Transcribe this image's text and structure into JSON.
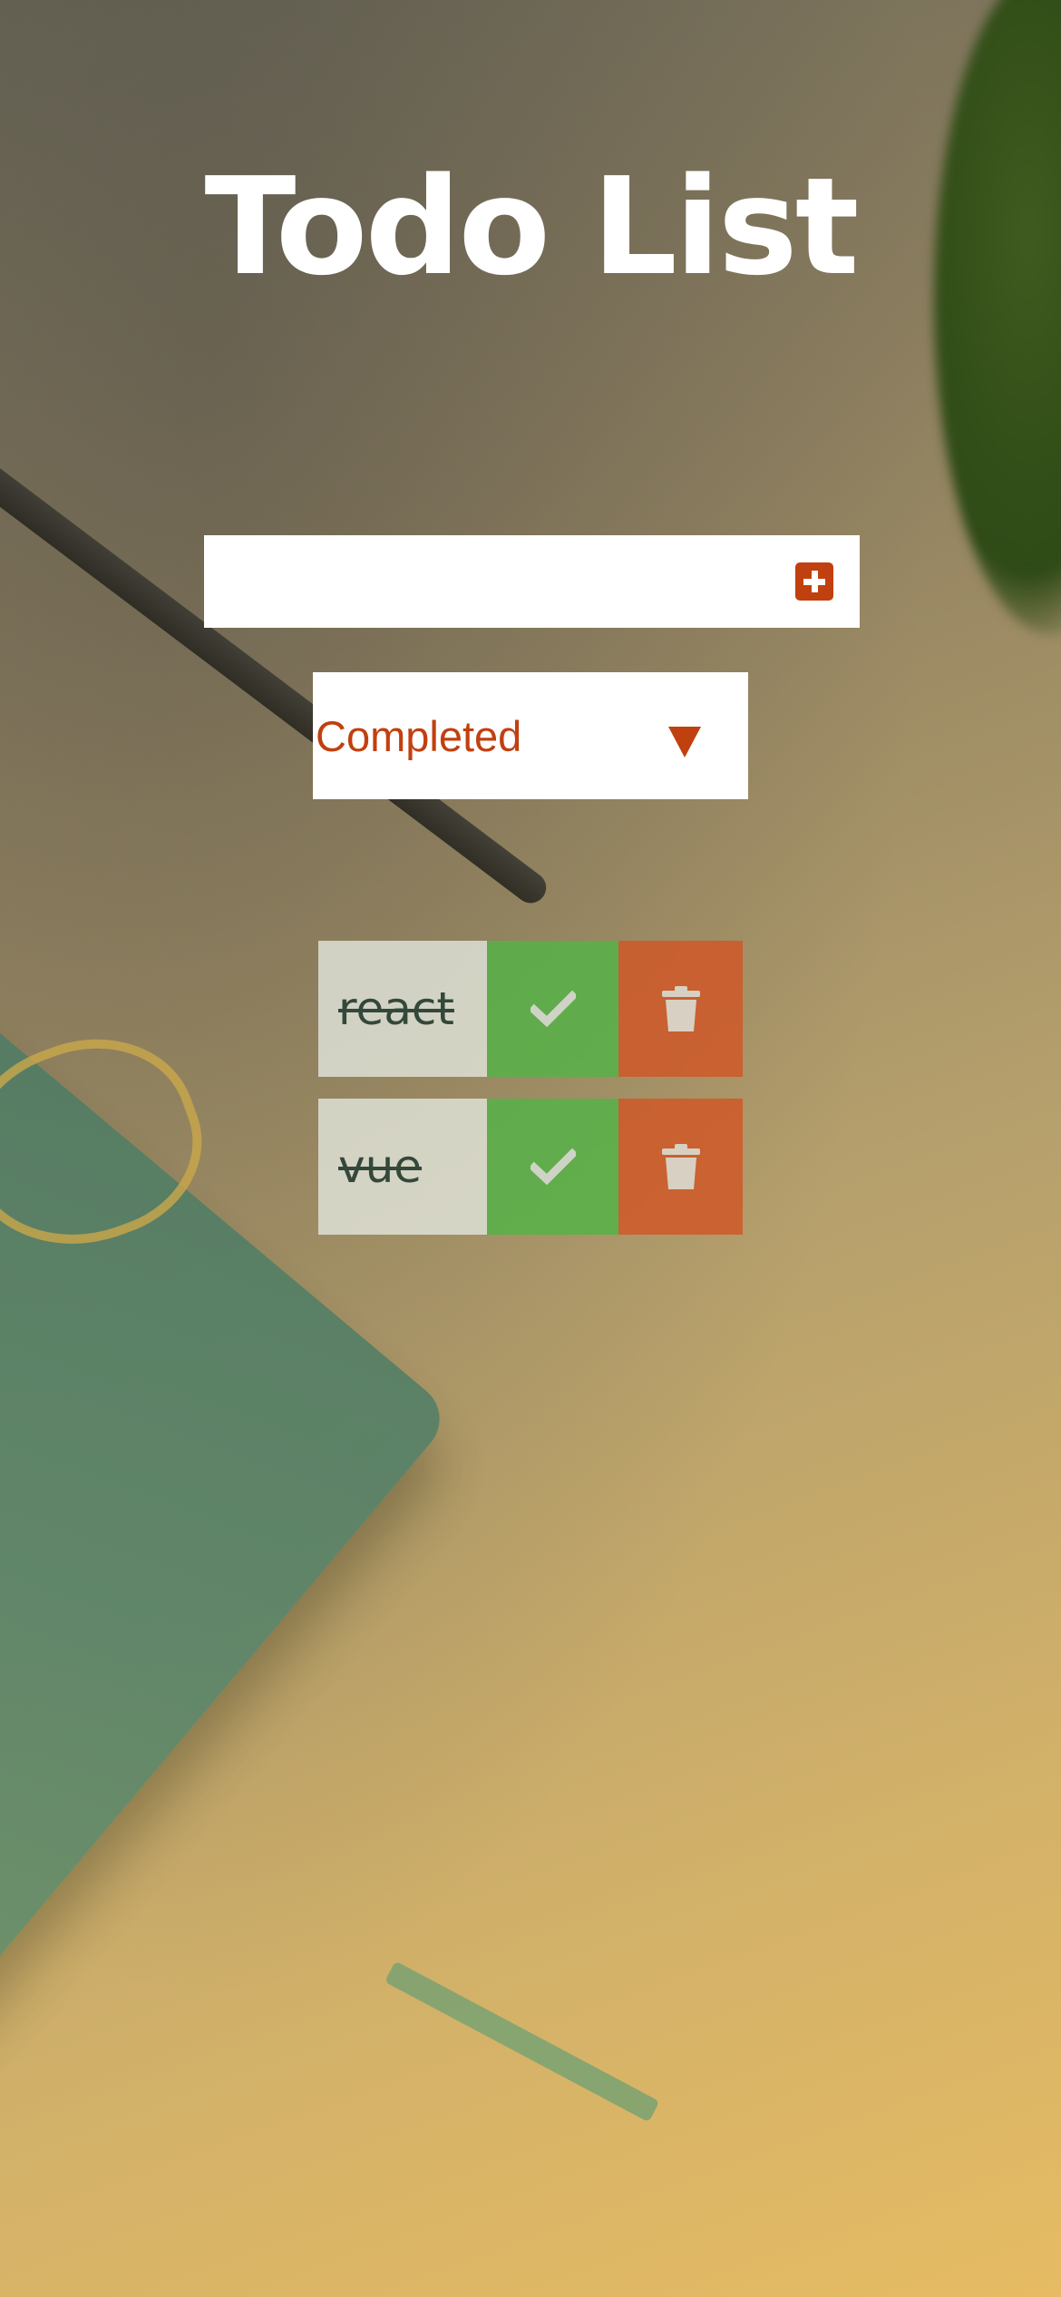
{
  "app": {
    "title": "Todo List"
  },
  "form": {
    "input_value": "",
    "input_placeholder": "",
    "add_icon": "plus-square-icon"
  },
  "filter": {
    "selected": "Completed",
    "arrow_icon": "caret-down-icon"
  },
  "todos": [
    {
      "text": "react",
      "completed": true
    },
    {
      "text": "vue",
      "completed": true
    }
  ],
  "colors": {
    "accent": "#c1400f",
    "complete": "#56b248",
    "delete": "#cf5828"
  }
}
